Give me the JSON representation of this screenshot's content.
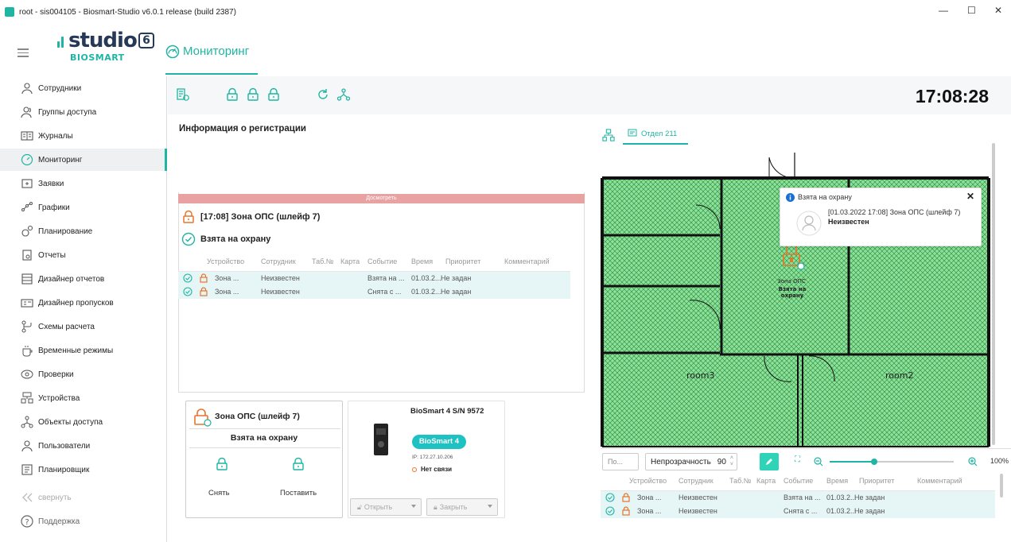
{
  "window": {
    "title": "root - sis004105 - Biosmart-Studio v6.0.1 release (build 2387)",
    "minimize": "—",
    "maximize": "☐",
    "close": "✕"
  },
  "logo": {
    "word": "studio",
    "version": "6",
    "brand": "BIOSMART"
  },
  "header": {
    "tab": "Мониторинг"
  },
  "sidebar": {
    "items": [
      {
        "label": "Сотрудники",
        "icon": "person-icon"
      },
      {
        "label": "Группы доступа",
        "icon": "group-icon"
      },
      {
        "label": "Журналы",
        "icon": "journal-icon"
      },
      {
        "label": "Мониторинг",
        "icon": "gauge-icon",
        "active": true
      },
      {
        "label": "Заявки",
        "icon": "request-icon"
      },
      {
        "label": "Графики",
        "icon": "chart-icon"
      },
      {
        "label": "Планирование",
        "icon": "planning-icon"
      },
      {
        "label": "Отчеты",
        "icon": "report-icon"
      },
      {
        "label": "Дизайнер отчетов",
        "icon": "report-designer-icon"
      },
      {
        "label": "Дизайнер пропусков",
        "icon": "pass-designer-icon"
      },
      {
        "label": "Схемы расчета",
        "icon": "calc-scheme-icon"
      },
      {
        "label": "Временные режимы",
        "icon": "time-mode-icon"
      },
      {
        "label": "Проверки",
        "icon": "check-icon"
      },
      {
        "label": "Устройства",
        "icon": "devices-icon"
      },
      {
        "label": "Объекты доступа",
        "icon": "access-objects-icon"
      },
      {
        "label": "Пользователи",
        "icon": "users-icon"
      },
      {
        "label": "Планировщик",
        "icon": "scheduler-icon"
      }
    ],
    "collapse": "свернуть",
    "support": "Поддержка"
  },
  "toolbar": {
    "clock": "17:08:28"
  },
  "registration": {
    "title": "Информация о регистрации",
    "banner": "Досмотреть",
    "zone": "[17:08] Зона ОПС (шлейф  7)",
    "state": "Взята на охрану",
    "columns": [
      "Устройство",
      "Сотрудник",
      "Таб.№",
      "Карта",
      "Событие",
      "Время",
      "Приоритет",
      "Комментарий"
    ],
    "rows": [
      {
        "device": "Зона ...",
        "employee": "Неизвестен",
        "event": "Взята на ...",
        "time": "01.03.2...",
        "priority": "Не задан"
      },
      {
        "device": "Зона ...",
        "employee": "Неизвестен",
        "event": "Снята с ...",
        "time": "01.03.2...",
        "priority": "Не задан"
      }
    ]
  },
  "zone_card": {
    "title": "Зона ОПС (шлейф  7)",
    "state": "Взята на охрану",
    "disarm": "Снять",
    "arm": "Поставить"
  },
  "device_card": {
    "title": "BioSmart 4 S/N 9572",
    "badge": "BioSmart 4",
    "ip": "IP: 172.27.10.206",
    "status": "Нет связи",
    "open": "Открыть",
    "close": "Закрыть"
  },
  "map": {
    "tab": "Отдел 211",
    "room3": "room3",
    "room2": "room2",
    "zone_label": "Зона ОПС",
    "zone_state": "Взята на охрану",
    "popup": {
      "title": "Взята на охрану",
      "text": "[01.03.2022 17:08] Зона ОПС (шлейф 7)",
      "person": "Неизвестен"
    },
    "search_placeholder": "По...",
    "opacity_label": "Непрозрачность",
    "opacity_value": "90",
    "zoom": "100%",
    "zoom_level": 0.36
  },
  "colors": {
    "accent": "#1fb5a4",
    "alarm": "#e8742a",
    "banner": "#e8a2a2",
    "row": "#e6f5f5",
    "zone_fill": "#8be09a"
  }
}
